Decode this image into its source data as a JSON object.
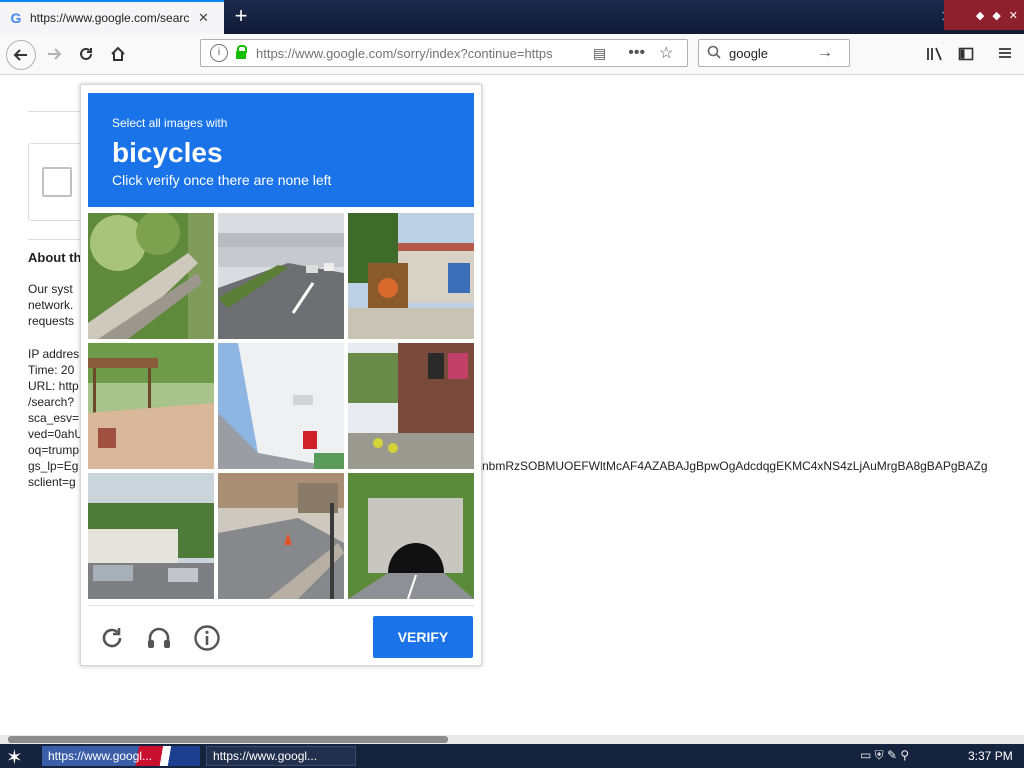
{
  "browser": {
    "tab_title": "https://www.google.com/search?",
    "tab_favicon": "G",
    "url": "https://www.google.com/sorry/index?continue=https",
    "search_query": "google"
  },
  "page": {
    "about_heading": "About th",
    "text_lines_1": [
      "Our syst",
      "network.",
      "requests"
    ],
    "text_lines_2": [
      "IP addres",
      "Time: 20",
      "URL: http",
      "/search?",
      "sca_esv=",
      "ved=0ahU",
      "oq=trump",
      "gs_lp=Eg",
      "sclient=g"
    ],
    "long_line": "nbmRzSOBMUOEFWltMcAF4AZABAJgBpwOgAdcdqgEKMC4xNS4zLjAuMrgBA8gBAPgBAZg"
  },
  "captcha": {
    "instruction": "Select all images with",
    "target": "bicycles",
    "subtext": "Click verify once there are none left",
    "verify_label": "VERIFY",
    "tiles": [
      {
        "name": "tile-fence-bushes"
      },
      {
        "name": "tile-highway"
      },
      {
        "name": "tile-street-shop"
      },
      {
        "name": "tile-bus-shelter"
      },
      {
        "name": "tile-white-building"
      },
      {
        "name": "tile-storefront"
      },
      {
        "name": "tile-truck-road"
      },
      {
        "name": "tile-city-street"
      },
      {
        "name": "tile-tunnel"
      }
    ]
  },
  "taskbar": {
    "task1": "https://www.googl...",
    "task2": "https://www.googl...",
    "clock": "3:37 PM"
  }
}
